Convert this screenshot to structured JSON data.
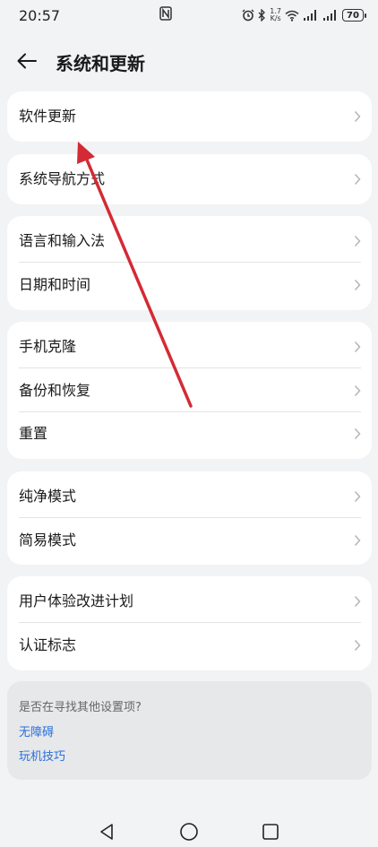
{
  "status_bar": {
    "time": "20:57",
    "speed_value": "1.7",
    "speed_unit": "K/s",
    "battery": "70"
  },
  "header": {
    "title": "系统和更新"
  },
  "groups": [
    {
      "items": [
        {
          "label": "软件更新"
        }
      ]
    },
    {
      "items": [
        {
          "label": "系统导航方式"
        }
      ]
    },
    {
      "items": [
        {
          "label": "语言和输入法"
        },
        {
          "label": "日期和时间"
        }
      ]
    },
    {
      "items": [
        {
          "label": "手机克隆"
        },
        {
          "label": "备份和恢复"
        },
        {
          "label": "重置"
        }
      ]
    },
    {
      "items": [
        {
          "label": "纯净模式"
        },
        {
          "label": "简易模式"
        }
      ]
    },
    {
      "items": [
        {
          "label": "用户体验改进计划"
        },
        {
          "label": "认证标志"
        }
      ]
    }
  ],
  "suggestions": {
    "question": "是否在寻找其他设置项?",
    "links": [
      "无障碍",
      "玩机技巧"
    ]
  },
  "annotation": {
    "color": "#d42a35"
  },
  "colors": {
    "link": "#2a6fdb",
    "background": "#f1f3f5",
    "card": "#ffffff"
  }
}
